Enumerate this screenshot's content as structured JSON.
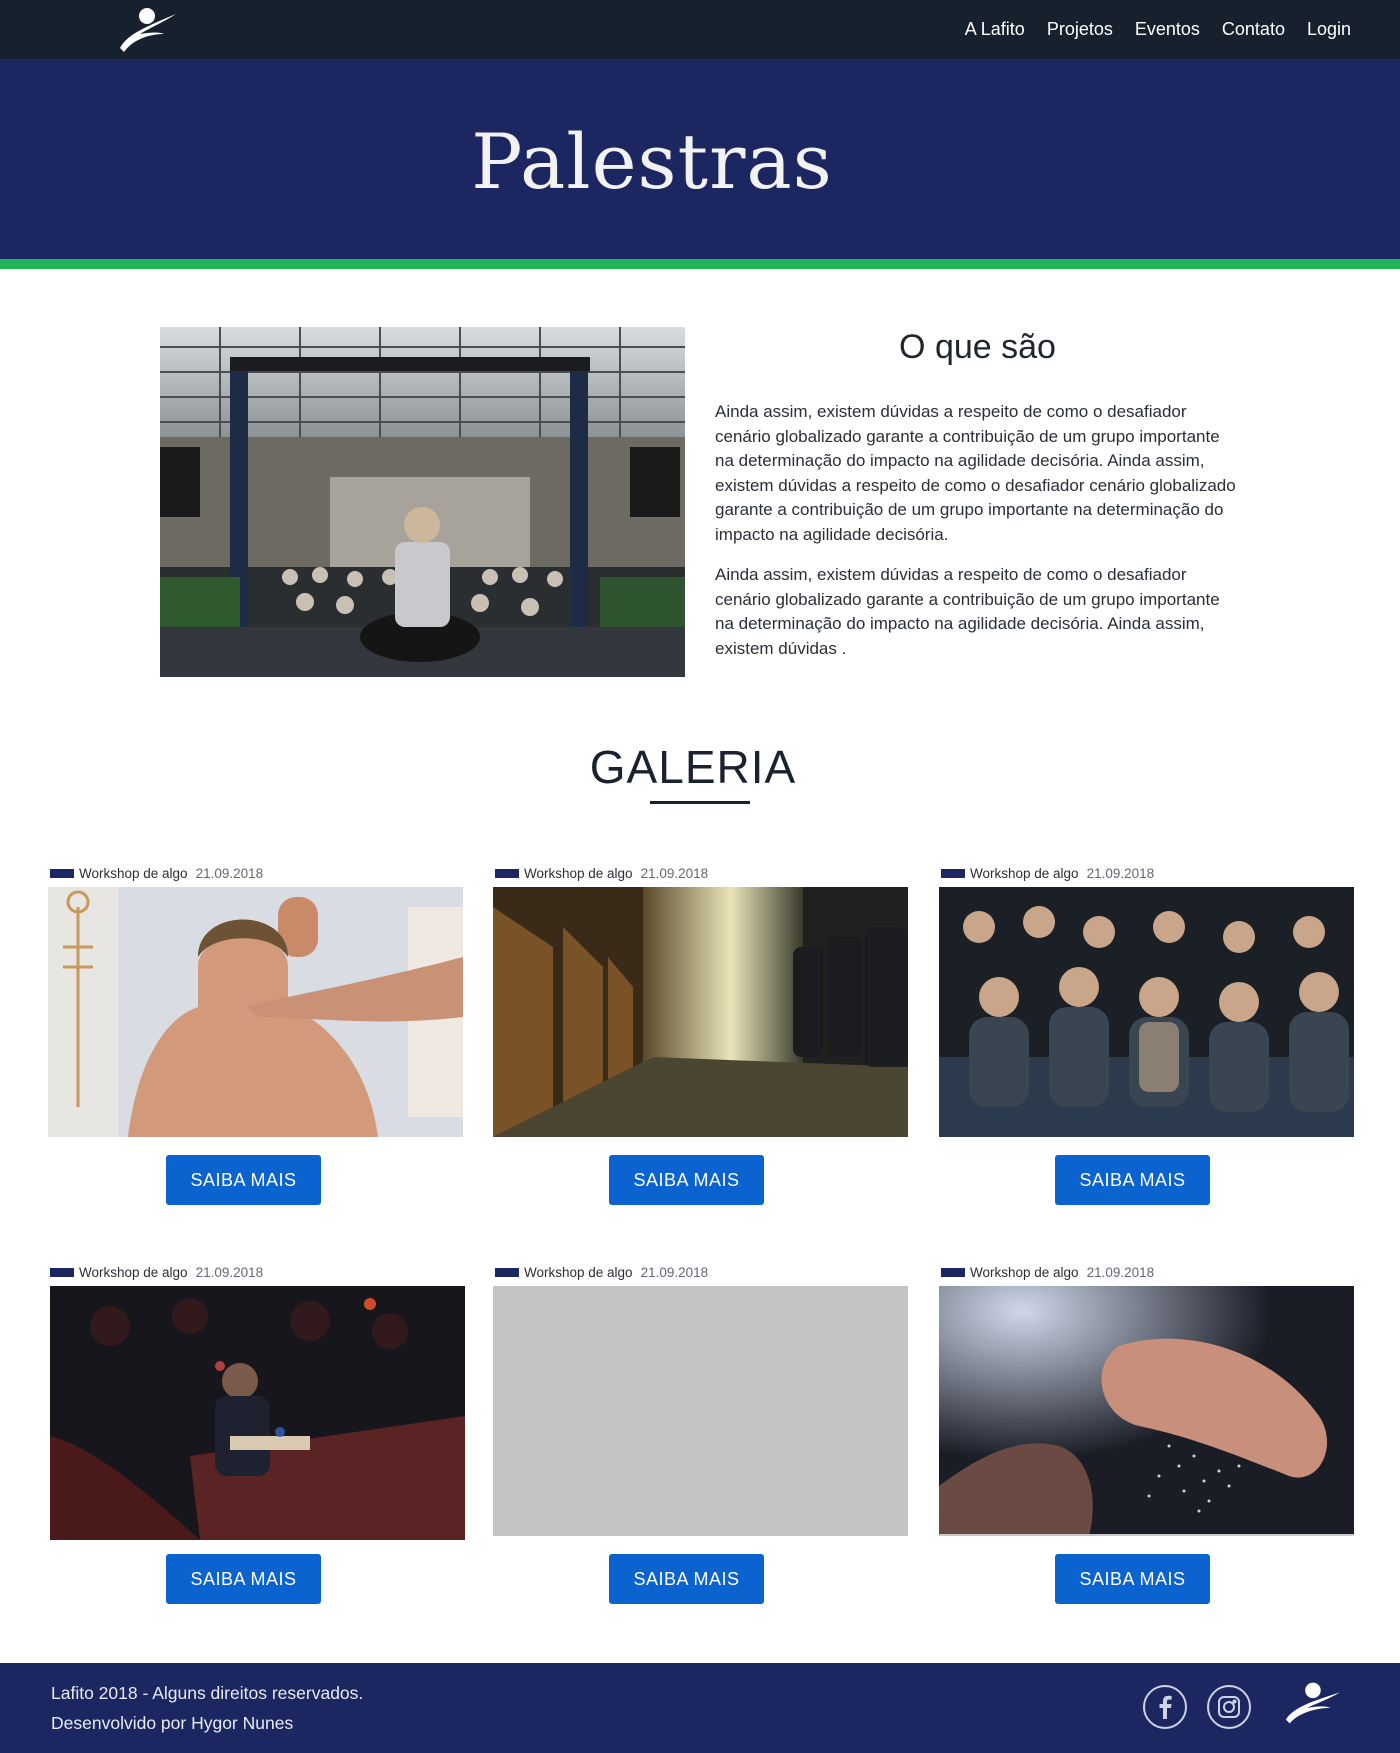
{
  "nav": {
    "logo": "lafito-logo-icon",
    "links": [
      "A Lafito",
      "Projetos",
      "Eventos",
      "Contato",
      "Login"
    ]
  },
  "hero": {
    "title": "Palestras"
  },
  "about": {
    "title": "O que são",
    "paragraph_1": "Ainda assim, existem dúvidas a respeito de como o desafiador cenário globalizado garante a contribuição de um grupo importante na determinação do impacto na agilidade decisória. Ainda assim, existem dúvidas a respeito de como o desafiador cenário globalizado garante a contribuição de um grupo importante na determinação do impacto na agilidade decisória.",
    "paragraph_2": "Ainda assim, existem dúvidas a respeito de como o desafiador cenário globalizado garante a contribuição de um grupo importante na determinação do impacto na agilidade decisória. Ainda assim, existem dúvidas ."
  },
  "gallery": {
    "title": "GALERIA",
    "cards": [
      {
        "category": "Workshop de algo",
        "date": "21.09.2018",
        "button": "SAIBA MAIS",
        "image": "massage-photo"
      },
      {
        "category": "Workshop de algo",
        "date": "21.09.2018",
        "button": "SAIBA MAIS",
        "image": "auditorium-seats-photo"
      },
      {
        "category": "Workshop de algo",
        "date": "21.09.2018",
        "button": "SAIBA MAIS",
        "image": "audience-photo"
      },
      {
        "category": "Workshop de algo",
        "date": "21.09.2018",
        "button": "SAIBA MAIS",
        "image": "lecture-hall-photo"
      },
      {
        "category": "Workshop de algo",
        "date": "21.09.2018",
        "button": "SAIBA MAIS",
        "image": "placeholder-image"
      },
      {
        "category": "Workshop de algo",
        "date": "21.09.2018",
        "button": "SAIBA MAIS",
        "image": "hands-powder-photo"
      }
    ]
  },
  "footer": {
    "line1": "Lafito 2018 - Alguns direitos reservados.",
    "line2": "Desenvolvido por Hygor Nunes",
    "social": [
      "facebook-icon",
      "instagram-icon"
    ]
  },
  "colors": {
    "navbar": "#17212e",
    "brand_navy": "#1c2761",
    "accent_green": "#21b459",
    "button_blue": "#0a63cf",
    "placeholder_gray": "#c4c4c4"
  }
}
